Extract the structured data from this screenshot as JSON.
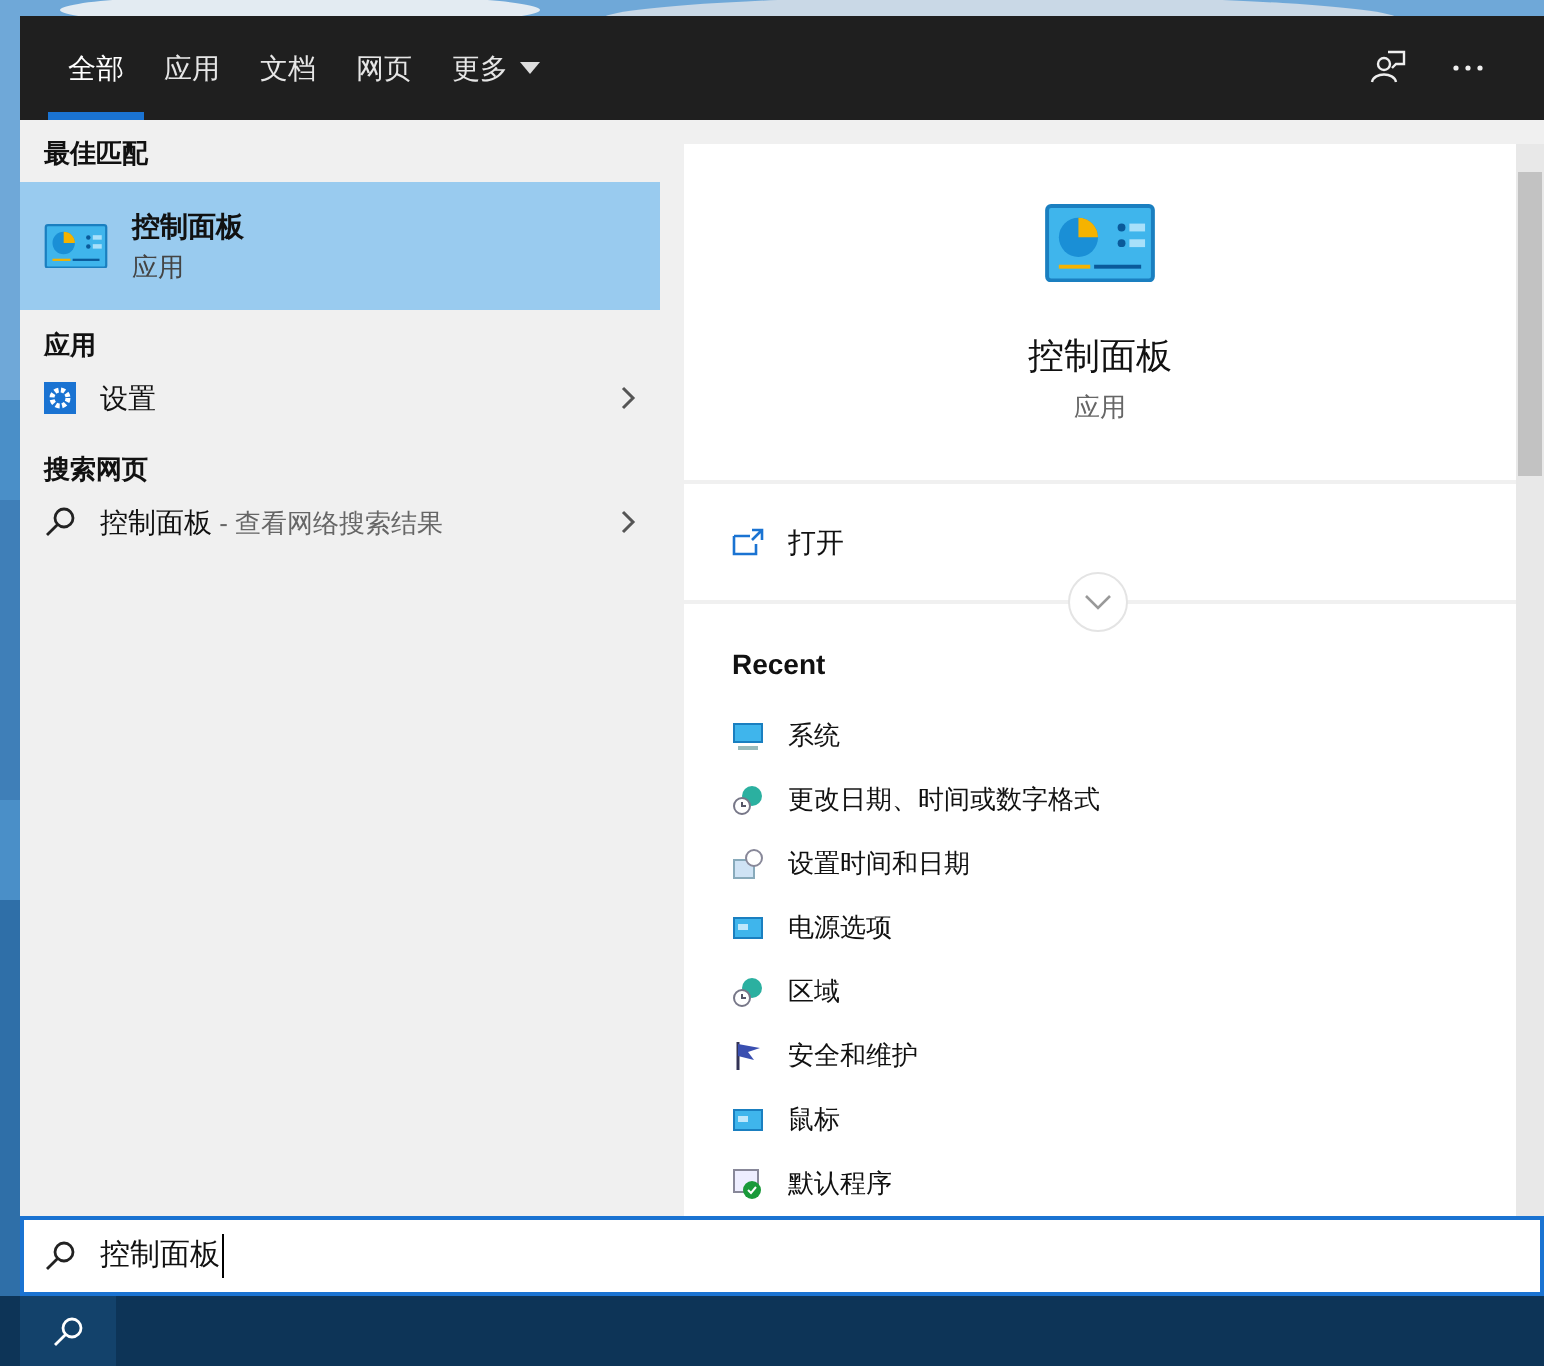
{
  "tabs": [
    {
      "label": "全部",
      "selected": true
    },
    {
      "label": "应用",
      "selected": false
    },
    {
      "label": "文档",
      "selected": false
    },
    {
      "label": "网页",
      "selected": false
    },
    {
      "label": "更多",
      "selected": false,
      "kind": "dropdown"
    }
  ],
  "left": {
    "best_match": {
      "heading": "最佳匹配",
      "title": "控制面板",
      "subtitle": "应用",
      "selected": true
    },
    "sections": [
      {
        "heading": "应用",
        "items": [
          {
            "kind": "settings",
            "label": "设置"
          }
        ]
      },
      {
        "heading": "搜索网页",
        "items": [
          {
            "kind": "web",
            "label": "控制面板",
            "hint": "- 查看网络搜索结果"
          }
        ]
      }
    ]
  },
  "preview": {
    "title": "控制面板",
    "subtitle": "应用",
    "actions": [
      {
        "label": "打开"
      }
    ],
    "recent_heading": "Recent",
    "recent": [
      {
        "kind": "monitor",
        "label": "系统"
      },
      {
        "kind": "globe",
        "label": "更改日期、时间或数字格式"
      },
      {
        "kind": "calendar",
        "label": "设置时间和日期"
      },
      {
        "kind": "panel",
        "label": "电源选项"
      },
      {
        "kind": "globe",
        "label": "区域"
      },
      {
        "kind": "flag",
        "label": "安全和维护"
      },
      {
        "kind": "panel",
        "label": "鼠标"
      },
      {
        "kind": "check",
        "label": "默认程序"
      }
    ]
  },
  "search": {
    "value": "控制面板"
  }
}
